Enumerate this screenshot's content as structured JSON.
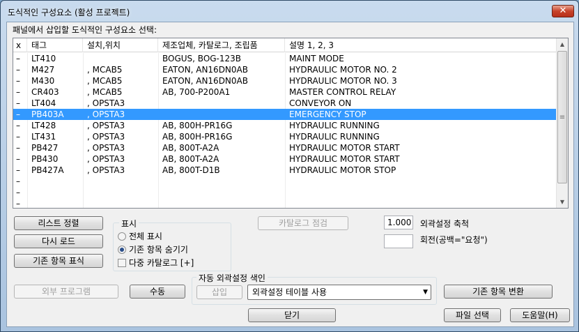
{
  "window": {
    "title": "도식적인 구성요소 (활성 프로젝트)",
    "close_glyph": "✕"
  },
  "prompt": "패널에서 삽입할 도식적인 구성요소 선택:",
  "table": {
    "headers": [
      "x",
      "태그",
      "설치,위치",
      "제조업체, 카탈로그, 조립품",
      "설명 1, 2, 3"
    ],
    "rows": [
      [
        "–",
        "LT410",
        "",
        "BOGUS, BOG-123B",
        "MAINT MODE"
      ],
      [
        "–",
        "M427",
        ", MCAB5",
        "EATON, AN16DN0AB",
        "HYDRAULIC MOTOR NO. 2"
      ],
      [
        "–",
        "M430",
        ", MCAB5",
        "EATON, AN16DN0AB",
        "HYDRAULIC MOTOR NO. 3"
      ],
      [
        "–",
        "CR403",
        ", MCAB5",
        "AB, 700-P200A1",
        "MASTER CONTROL RELAY"
      ],
      [
        "–",
        "LT404",
        ", OPSTA3",
        "",
        "CONVEYOR ON"
      ],
      [
        "–",
        "PB403A",
        ", OPSTA3",
        "",
        "EMERGENCY STOP"
      ],
      [
        "–",
        "LT428",
        ", OPSTA3",
        "AB, 800H-PR16G",
        "HYDRAULIC RUNNING"
      ],
      [
        "–",
        "LT431",
        ", OPSTA3",
        "AB, 800H-PR16G",
        "HYDRAULIC RUNNING"
      ],
      [
        "–",
        "PB427",
        ", OPSTA3",
        "AB, 800T-A2A",
        "HYDRAULIC MOTOR START"
      ],
      [
        "–",
        "PB430",
        ", OPSTA3",
        "AB, 800T-A2A",
        "HYDRAULIC MOTOR START"
      ],
      [
        "–",
        "PB427A",
        ", OPSTA3",
        "AB, 800T-D1B",
        "HYDRAULIC MOTOR STOP"
      ],
      [
        "–",
        "",
        "",
        "",
        ""
      ],
      [
        "–",
        "",
        "",
        "",
        ""
      ],
      [
        "–",
        "",
        "",
        "",
        ""
      ]
    ],
    "selected_row_index": 5,
    "scroll_up_glyph": "▲",
    "scroll_down_glyph": "▼",
    "scroll_grip_glyph": "≡"
  },
  "buttons": {
    "sort_list": "리스트 정렬",
    "reload": "다시 로드",
    "mark_existing": "기존 항목 표식",
    "catalog_check": "카탈로그 점검",
    "external_program": "외부 프로그램",
    "manual": "수동",
    "insert": "삽입",
    "convert_existing": "기존 항목 변환",
    "close": "닫기",
    "file_select": "파일 선택",
    "help": "도움말(H)"
  },
  "display_group": {
    "label": "표시",
    "show_all": "전체 표시",
    "hide_existing": "기존 항목 숨기기",
    "multi_catalog": "다중 카탈로그 [+]",
    "selected": "hide_existing",
    "multi_catalog_checked": false
  },
  "scale": {
    "value": "1.000",
    "label": "외곽설정 축척"
  },
  "rotation": {
    "value": "",
    "label": "회전(공백=\"요청\")"
  },
  "auto_index": {
    "label": "자동 외곽설정 색인",
    "combo_value": "외곽설정 테이블 사용",
    "combo_arrow_glyph": "▼"
  }
}
